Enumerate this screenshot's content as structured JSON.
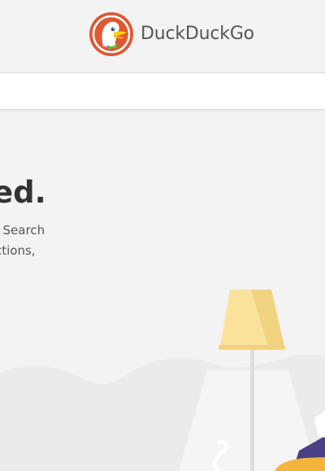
{
  "header": {
    "brand_name": "DuckDuckGo",
    "logo_icon": "duckduckgo-logo-icon"
  },
  "search": {
    "placeholder": "",
    "value": ""
  },
  "hero": {
    "headline": "ed.",
    "body_line_1": ". Search",
    "body_line_2": "ctions,"
  },
  "colors": {
    "logo_orange": "#de5833",
    "lamp_shade": "#fbe29b",
    "lamp_shade_shadow": "#f1d37f",
    "lamp_pole": "#dddddd",
    "floor": "#ebebeb",
    "sofa": "#f4b23e",
    "purple": "#4b3f86"
  }
}
